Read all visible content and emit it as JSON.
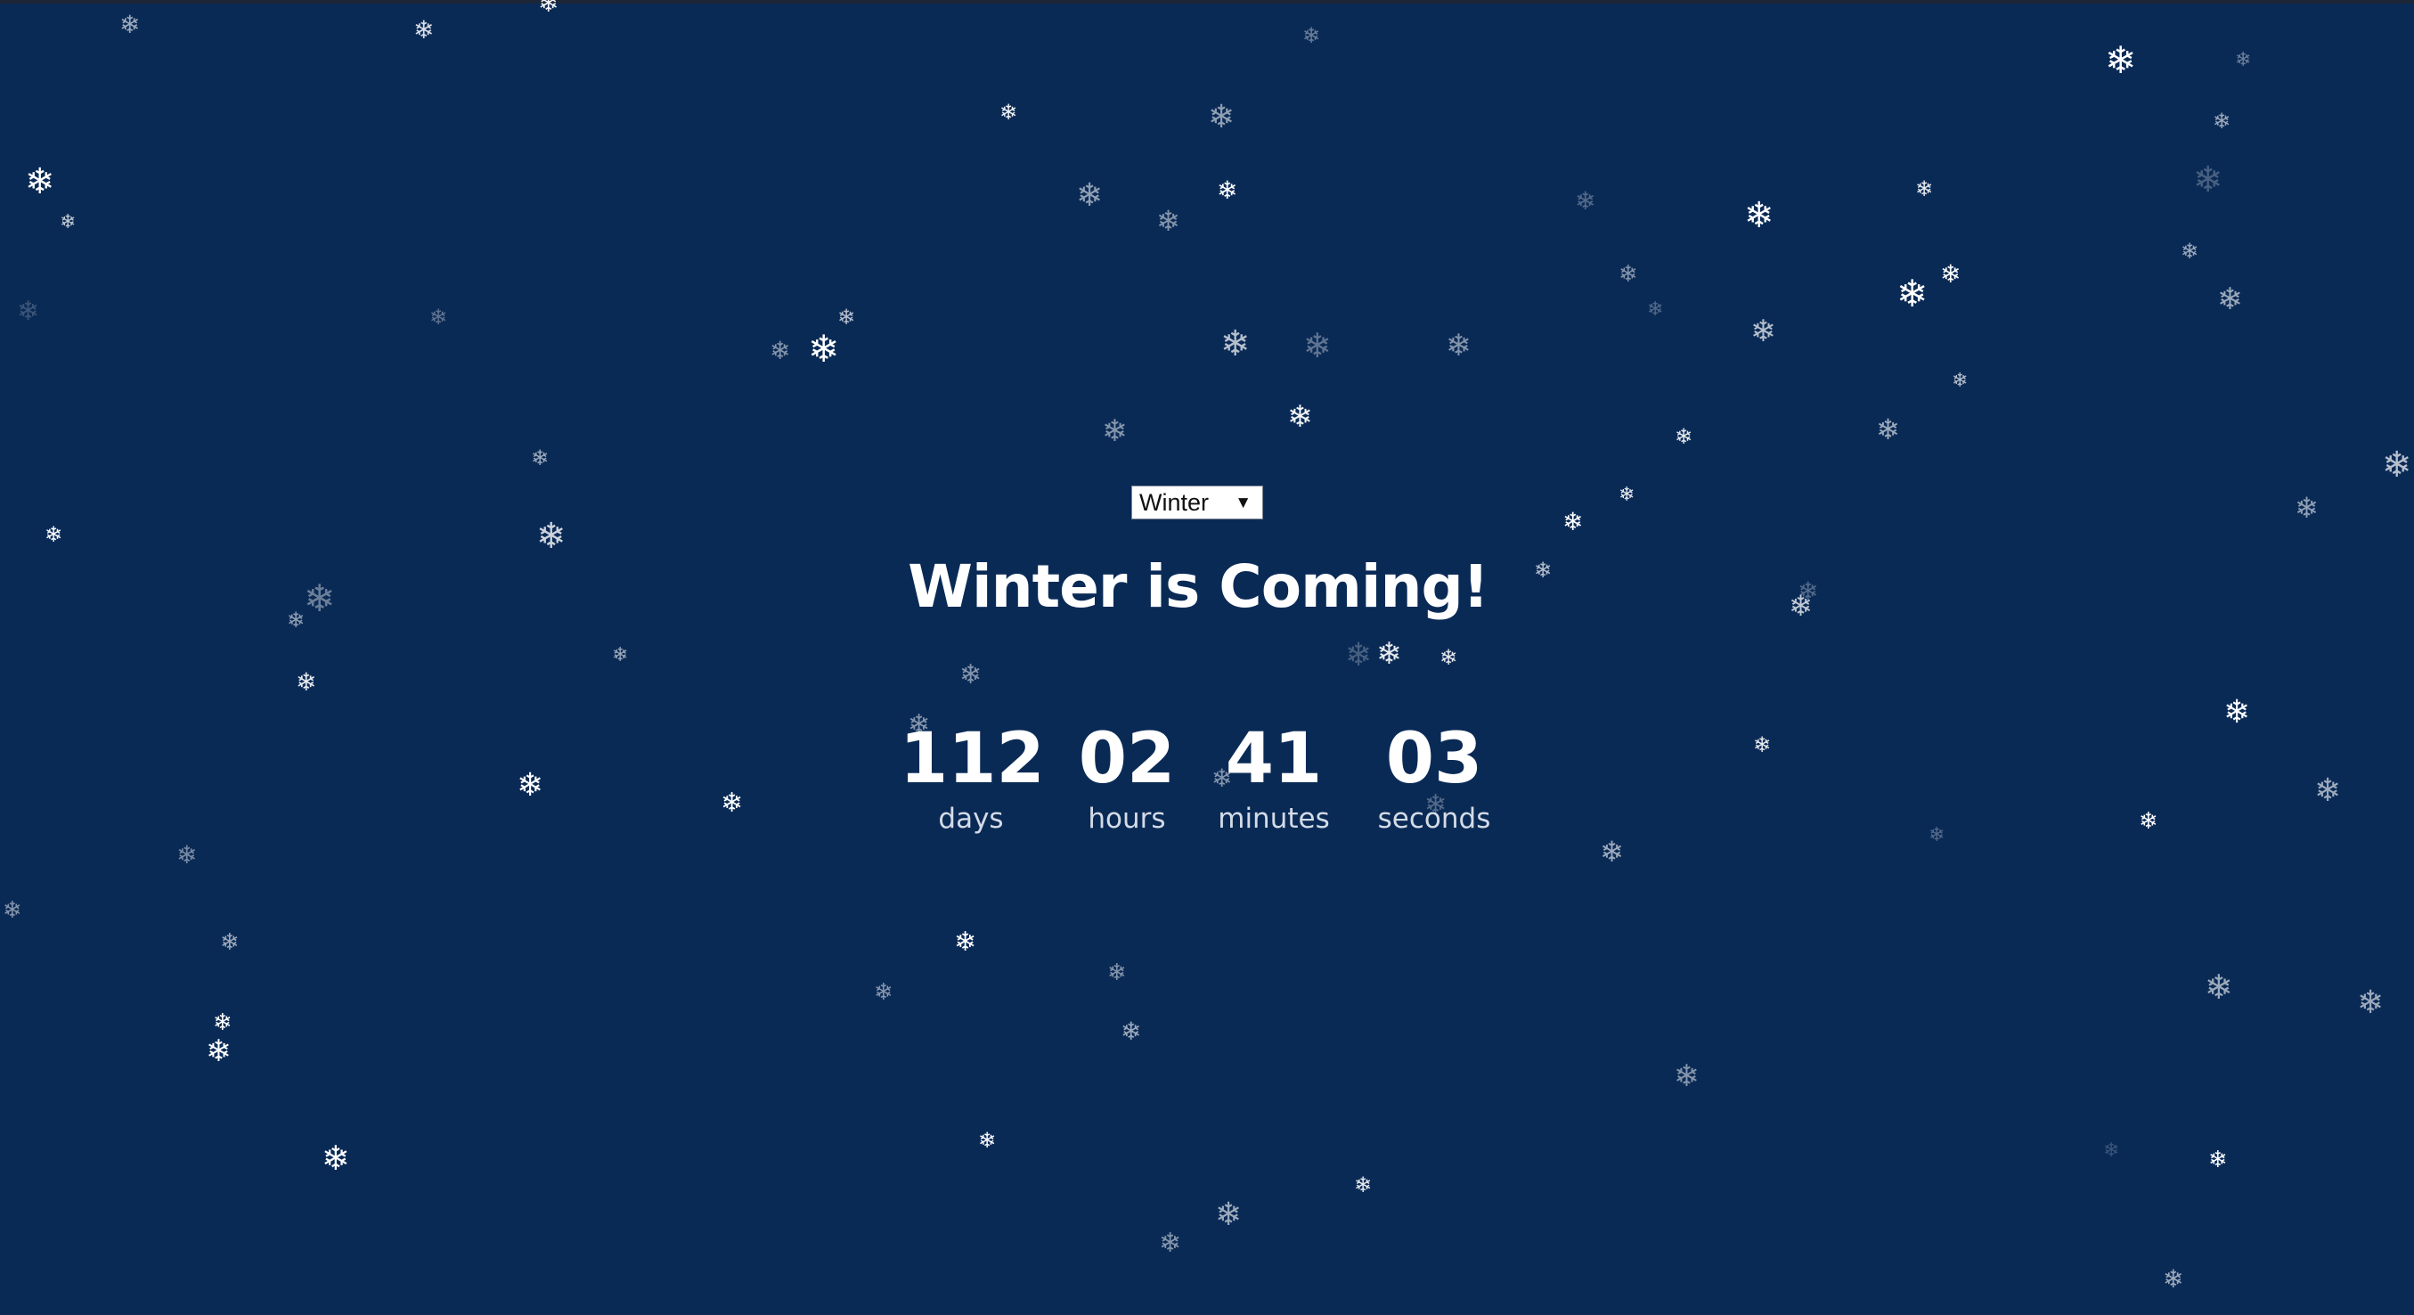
{
  "season_select": {
    "selected": "Winter",
    "arrow_icon": "triangle-down-icon"
  },
  "title": "Winter is Coming!",
  "countdown": [
    {
      "value": "112",
      "label": "days"
    },
    {
      "value": "02",
      "label": "hours"
    },
    {
      "value": "41",
      "label": "minutes"
    },
    {
      "value": "03",
      "label": "seconds"
    }
  ],
  "colors": {
    "background": "#0a2a56",
    "text": "#ffffff",
    "label": "#d4dbe6"
  },
  "snowflake_icon": "snowflake-icon"
}
